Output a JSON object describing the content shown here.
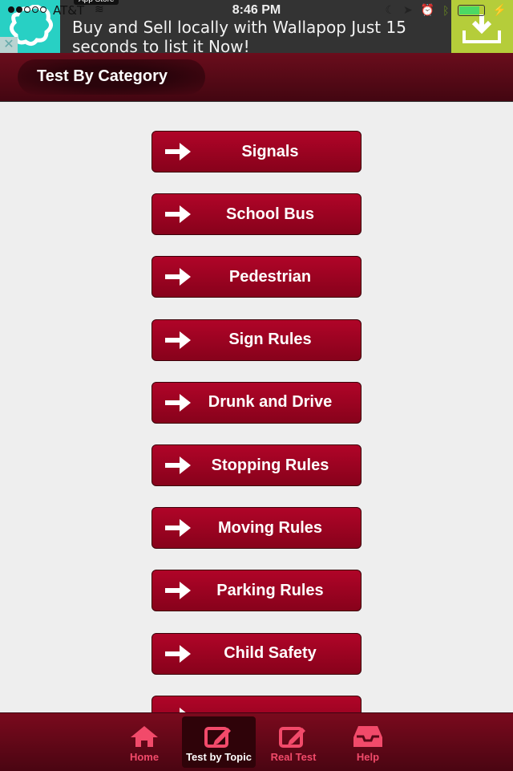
{
  "status_bar": {
    "carrier": "AT&T",
    "time": "8:46 PM",
    "app_store_badge": "App Store",
    "signal_bars_filled": 2,
    "signal_bars_total": 5,
    "battery_level": 0.8
  },
  "ad": {
    "text": "Buy and Sell locally with Wallapop Just 15 seconds to list it Now!",
    "close_icon": "close-icon",
    "download_icon": "download-icon",
    "colors": {
      "logo_bg": "#28d0c4",
      "download_bg": "#b5cd3a"
    }
  },
  "header": {
    "title": "Test By Category"
  },
  "categories": [
    {
      "label": "Signals"
    },
    {
      "label": "School Bus"
    },
    {
      "label": "Pedestrian"
    },
    {
      "label": "Sign Rules"
    },
    {
      "label": "Drunk and Drive"
    },
    {
      "label": "Stopping Rules"
    },
    {
      "label": "Moving Rules"
    },
    {
      "label": "Parking Rules"
    },
    {
      "label": "Child Safety"
    },
    {
      "label": ""
    }
  ],
  "tabbar": {
    "tabs": [
      {
        "label": "Home",
        "icon": "home-icon",
        "active": false
      },
      {
        "label": "Test by Topic",
        "icon": "edit-icon",
        "active": true
      },
      {
        "label": "Real Test",
        "icon": "edit-icon",
        "active": false
      },
      {
        "label": "Help",
        "icon": "inbox-icon",
        "active": false
      }
    ]
  },
  "colors": {
    "accent": "#a00325",
    "tab_inactive": "#f24a6a",
    "background": "#eeeeee"
  }
}
